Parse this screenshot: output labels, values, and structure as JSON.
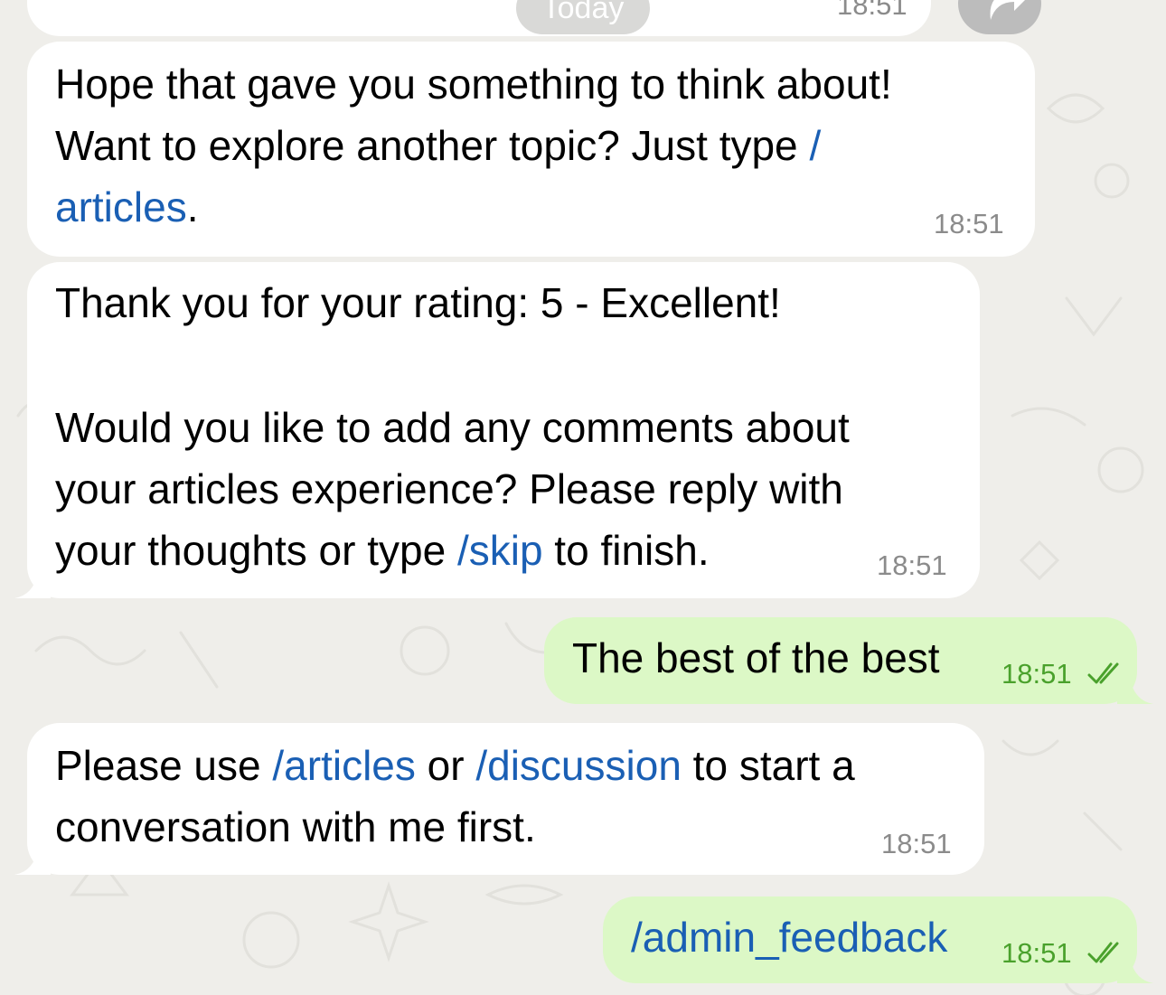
{
  "date_separator": "Today",
  "top_clipped_time": "18:51",
  "messages": [
    {
      "direction": "incoming",
      "lines": [
        [
          {
            "t": "Hope that gave you something to think about!"
          }
        ],
        [
          {
            "t": "Want to explore another topic? Just type "
          },
          {
            "t": "/",
            "link": true
          }
        ],
        [
          {
            "t": "articles",
            "link": true
          },
          {
            "t": "."
          }
        ]
      ],
      "time": "18:51"
    },
    {
      "direction": "incoming",
      "lines": [
        [
          {
            "t": "Thank you for your rating: 5 - Excellent!"
          }
        ],
        [],
        [
          {
            "t": "Would you like to add any comments about"
          }
        ],
        [
          {
            "t": "your articles experience? Please reply with"
          }
        ],
        [
          {
            "t": "your thoughts or type "
          },
          {
            "t": "/skip",
            "link": true
          },
          {
            "t": " to finish."
          }
        ]
      ],
      "time": "18:51"
    },
    {
      "direction": "outgoing",
      "lines": [
        [
          {
            "t": "The best of the best"
          }
        ]
      ],
      "time": "18:51",
      "status": "read"
    },
    {
      "direction": "incoming",
      "lines": [
        [
          {
            "t": "Please use "
          },
          {
            "t": "/articles",
            "link": true
          },
          {
            "t": " or "
          },
          {
            "t": "/discussion",
            "link": true
          },
          {
            "t": " to start a"
          }
        ],
        [
          {
            "t": "conversation with me first."
          }
        ]
      ],
      "time": "18:51"
    },
    {
      "direction": "outgoing",
      "lines": [
        [
          {
            "t": "/admin_feedback",
            "link": true
          }
        ]
      ],
      "time": "18:51",
      "status": "read"
    }
  ],
  "colors": {
    "background": "#efeeea",
    "incoming_bubble": "#ffffff",
    "outgoing_bubble": "#dcf8c6",
    "link": "#1a5fb4",
    "outgoing_time": "#4aa12c",
    "incoming_time": "#8b8b8b"
  },
  "icons": {
    "read_status": "double-check-icon",
    "forward": "forward-arrow-icon"
  }
}
